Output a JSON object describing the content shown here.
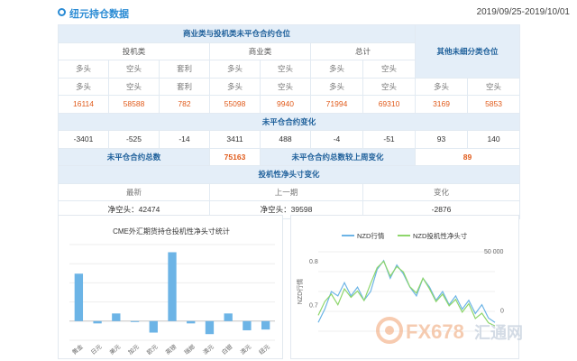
{
  "header": {
    "title": "纽元持仓数据",
    "date_range": "2019/09/25-2019/10/01"
  },
  "table": {
    "section_reportable": "商业类与投机类未平仓合约仓位",
    "section_nonreportable": "其他未细分类仓位",
    "group_noncommercial": "投机类",
    "group_commercial": "商业类",
    "group_total": "总计",
    "col_long": "多头",
    "col_short": "空头",
    "col_spread": "套利",
    "values": [
      "16114",
      "58588",
      "782",
      "55098",
      "9940",
      "71994",
      "69310",
      "3169",
      "5853"
    ],
    "section_change": "未平仓合约变化",
    "changes": [
      "-3401",
      "-525",
      "-14",
      "3411",
      "488",
      "-4",
      "-51",
      "93",
      "140"
    ],
    "oi_total_label": "未平仓合约总数",
    "oi_total_value": "75163",
    "oi_week_change_label": "未平仓合约总数较上周变化",
    "oi_week_change_value": "89",
    "section_net": "投机性净头寸变化",
    "net_latest_label": "最新",
    "net_prev_label": "上一期",
    "net_change_label": "变化",
    "net_latest_value": "净空头：42474",
    "net_prev_value": "净空头：39598",
    "net_change_value": "-2876"
  },
  "chart_data": [
    {
      "type": "bar",
      "title": "CME外汇期货持仓投机性净头寸统计",
      "categories": [
        "黄金",
        "日元",
        "美元",
        "加元",
        "欧元",
        "英镑",
        "瑞郎",
        "澳元",
        "白银",
        "澳元",
        "纽元"
      ],
      "values": [
        0.62,
        -0.03,
        0.1,
        0.0,
        -0.15,
        0.9,
        -0.03,
        -0.17,
        0.1,
        -0.12,
        -0.11
      ],
      "grid": true
    },
    {
      "type": "line",
      "legend": [
        "NZD行情",
        "NZD投机性净头寸"
      ],
      "legend_position": "top",
      "y_left_label": "NZD行情",
      "y_left_ticks": [
        "0.8",
        "0.7"
      ],
      "y_right_ticks": [
        "50 000",
        "0"
      ],
      "colors": {
        "nzd": "#6cb4e6",
        "net": "#8ed66b"
      },
      "series": [
        {
          "name": "NZD行情",
          "values": [
            0.66,
            0.69,
            0.73,
            0.72,
            0.75,
            0.72,
            0.74,
            0.71,
            0.73,
            0.78,
            0.8,
            0.76,
            0.79,
            0.77,
            0.74,
            0.72,
            0.76,
            0.74,
            0.71,
            0.73,
            0.7,
            0.72,
            0.69,
            0.71,
            0.68,
            0.7,
            0.67,
            0.66
          ]
        },
        {
          "name": "NZD投机性净头寸",
          "values": [
            -5000,
            8000,
            15000,
            5000,
            20000,
            12000,
            18000,
            9000,
            25000,
            40000,
            46000,
            32000,
            41000,
            36000,
            22000,
            16000,
            30000,
            20000,
            8000,
            15000,
            4000,
            10000,
            -2000,
            6000,
            -8000,
            -3000,
            -12000,
            -15000
          ]
        }
      ]
    }
  ],
  "watermark": {
    "brand": "FX678",
    "sub": "汇通网"
  }
}
